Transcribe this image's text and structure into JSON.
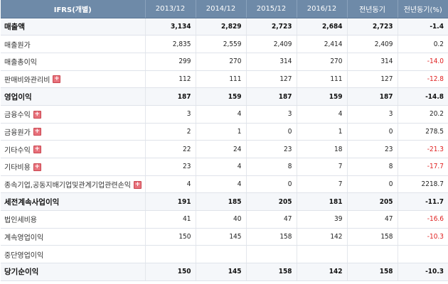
{
  "headers": [
    "IFRS(개별)",
    "2013/12",
    "2014/12",
    "2015/12",
    "2016/12",
    "전년동기",
    "전년동기(%)"
  ],
  "rows": [
    {
      "label": "매출액",
      "bold": true,
      "expand": false,
      "values": [
        "3,134",
        "2,829",
        "2,723",
        "2,684",
        "2,723"
      ],
      "pct": "-1.4",
      "neg": true
    },
    {
      "label": "매출원가",
      "bold": false,
      "expand": false,
      "values": [
        "2,835",
        "2,559",
        "2,409",
        "2,414",
        "2,409"
      ],
      "pct": "0.2",
      "neg": false
    },
    {
      "label": "매출총이익",
      "bold": false,
      "expand": false,
      "values": [
        "299",
        "270",
        "314",
        "270",
        "314"
      ],
      "pct": "-14.0",
      "neg": true
    },
    {
      "label": "판매비와관리비",
      "bold": false,
      "expand": true,
      "values": [
        "112",
        "111",
        "127",
        "111",
        "127"
      ],
      "pct": "-12.8",
      "neg": true
    },
    {
      "label": "영업이익",
      "bold": true,
      "expand": false,
      "values": [
        "187",
        "159",
        "187",
        "159",
        "187"
      ],
      "pct": "-14.8",
      "neg": true
    },
    {
      "label": "금융수익",
      "bold": false,
      "expand": true,
      "values": [
        "3",
        "4",
        "3",
        "4",
        "3"
      ],
      "pct": "20.2",
      "neg": false
    },
    {
      "label": "금융원가",
      "bold": false,
      "expand": true,
      "values": [
        "2",
        "1",
        "0",
        "1",
        "0"
      ],
      "pct": "278.5",
      "neg": false
    },
    {
      "label": "기타수익",
      "bold": false,
      "expand": true,
      "values": [
        "22",
        "24",
        "23",
        "18",
        "23"
      ],
      "pct": "-21.3",
      "neg": true
    },
    {
      "label": "기타비용",
      "bold": false,
      "expand": true,
      "values": [
        "23",
        "4",
        "8",
        "7",
        "8"
      ],
      "pct": "-17.7",
      "neg": true
    },
    {
      "label": "종속기업,공동지배기업및관계기업관련손익",
      "bold": false,
      "expand": true,
      "values": [
        "4",
        "4",
        "0",
        "7",
        "0"
      ],
      "pct": "2218.7",
      "neg": false
    },
    {
      "label": "세전계속사업이익",
      "bold": true,
      "expand": false,
      "values": [
        "191",
        "185",
        "205",
        "181",
        "205"
      ],
      "pct": "-11.7",
      "neg": true
    },
    {
      "label": "법인세비용",
      "bold": false,
      "expand": false,
      "values": [
        "41",
        "40",
        "47",
        "39",
        "47"
      ],
      "pct": "-16.6",
      "neg": true
    },
    {
      "label": "계속영업이익",
      "bold": false,
      "expand": false,
      "values": [
        "150",
        "145",
        "158",
        "142",
        "158"
      ],
      "pct": "-10.3",
      "neg": true
    },
    {
      "label": "중단영업이익",
      "bold": false,
      "expand": false,
      "values": [
        "",
        "",
        "",
        "",
        ""
      ],
      "pct": "",
      "neg": false
    },
    {
      "label": "당기순이익",
      "bold": true,
      "expand": false,
      "values": [
        "150",
        "145",
        "158",
        "142",
        "158"
      ],
      "pct": "-10.3",
      "neg": true
    }
  ],
  "colors": {
    "header_bg": "#6e8aa8",
    "negative": "#e02020",
    "expand_icon": "#e8727c"
  }
}
